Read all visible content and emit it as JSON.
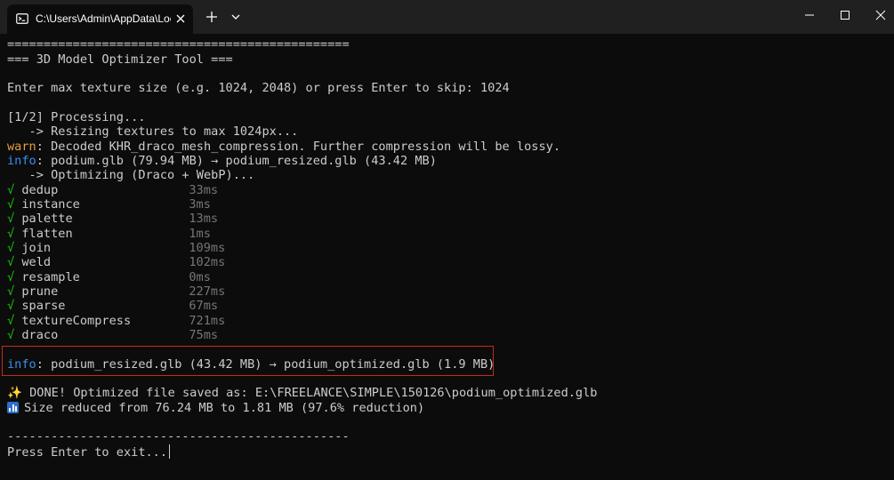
{
  "tab": {
    "title": "C:\\Users\\Admin\\AppData\\Loc"
  },
  "terminal": {
    "separator_top": "===============================================",
    "header": "=== 3D Model Optimizer Tool ===",
    "prompt_texture": "Enter max texture size (e.g. 1024, 2048) or press Enter to skip: 1024",
    "processing": "[1/2] Processing...",
    "resizing": "   -> Resizing textures to max 1024px...",
    "warn_label": "warn",
    "warn_message": ": Decoded KHR_draco_mesh_compression. Further compression will be lossy.",
    "info_label": "info",
    "info_resize_message": ": podium.glb (79.94 MB) → podium_resized.glb (43.42 MB)",
    "optimizing": "   -> Optimizing (Draco + WebP)...",
    "check_mark": "√",
    "steps": [
      {
        "name": "dedup",
        "time": "33ms"
      },
      {
        "name": "instance",
        "time": "3ms"
      },
      {
        "name": "palette",
        "time": "13ms"
      },
      {
        "name": "flatten",
        "time": "1ms"
      },
      {
        "name": "join",
        "time": "109ms"
      },
      {
        "name": "weld",
        "time": "102ms"
      },
      {
        "name": "resample",
        "time": "0ms"
      },
      {
        "name": "prune",
        "time": "227ms"
      },
      {
        "name": "sparse",
        "time": "67ms"
      },
      {
        "name": "textureCompress",
        "time": "721ms"
      },
      {
        "name": "draco",
        "time": "75ms"
      }
    ],
    "info_optimized_message": ": podium_resized.glb (43.42 MB) → podium_optimized.glb (1.9 MB)",
    "done_icon": "✨",
    "done_message": " DONE! Optimized file saved as: E:\\FREELANCE\\SIMPLE\\150126\\podium_optimized.glb",
    "size_icon": "bar-chart-icon",
    "size_message": "Size reduced from 76.24 MB to 1.81 MB (97.6% reduction)",
    "separator_bottom": "-----------------------------------------------",
    "exit_prompt": "Press Enter to exit..."
  },
  "colors": {
    "background": "#0c0c0c",
    "text": "#cccccc",
    "warn": "#e5a03a",
    "info": "#3b8eea",
    "check": "#16c60c",
    "highlight_border": "#c42b1c"
  }
}
